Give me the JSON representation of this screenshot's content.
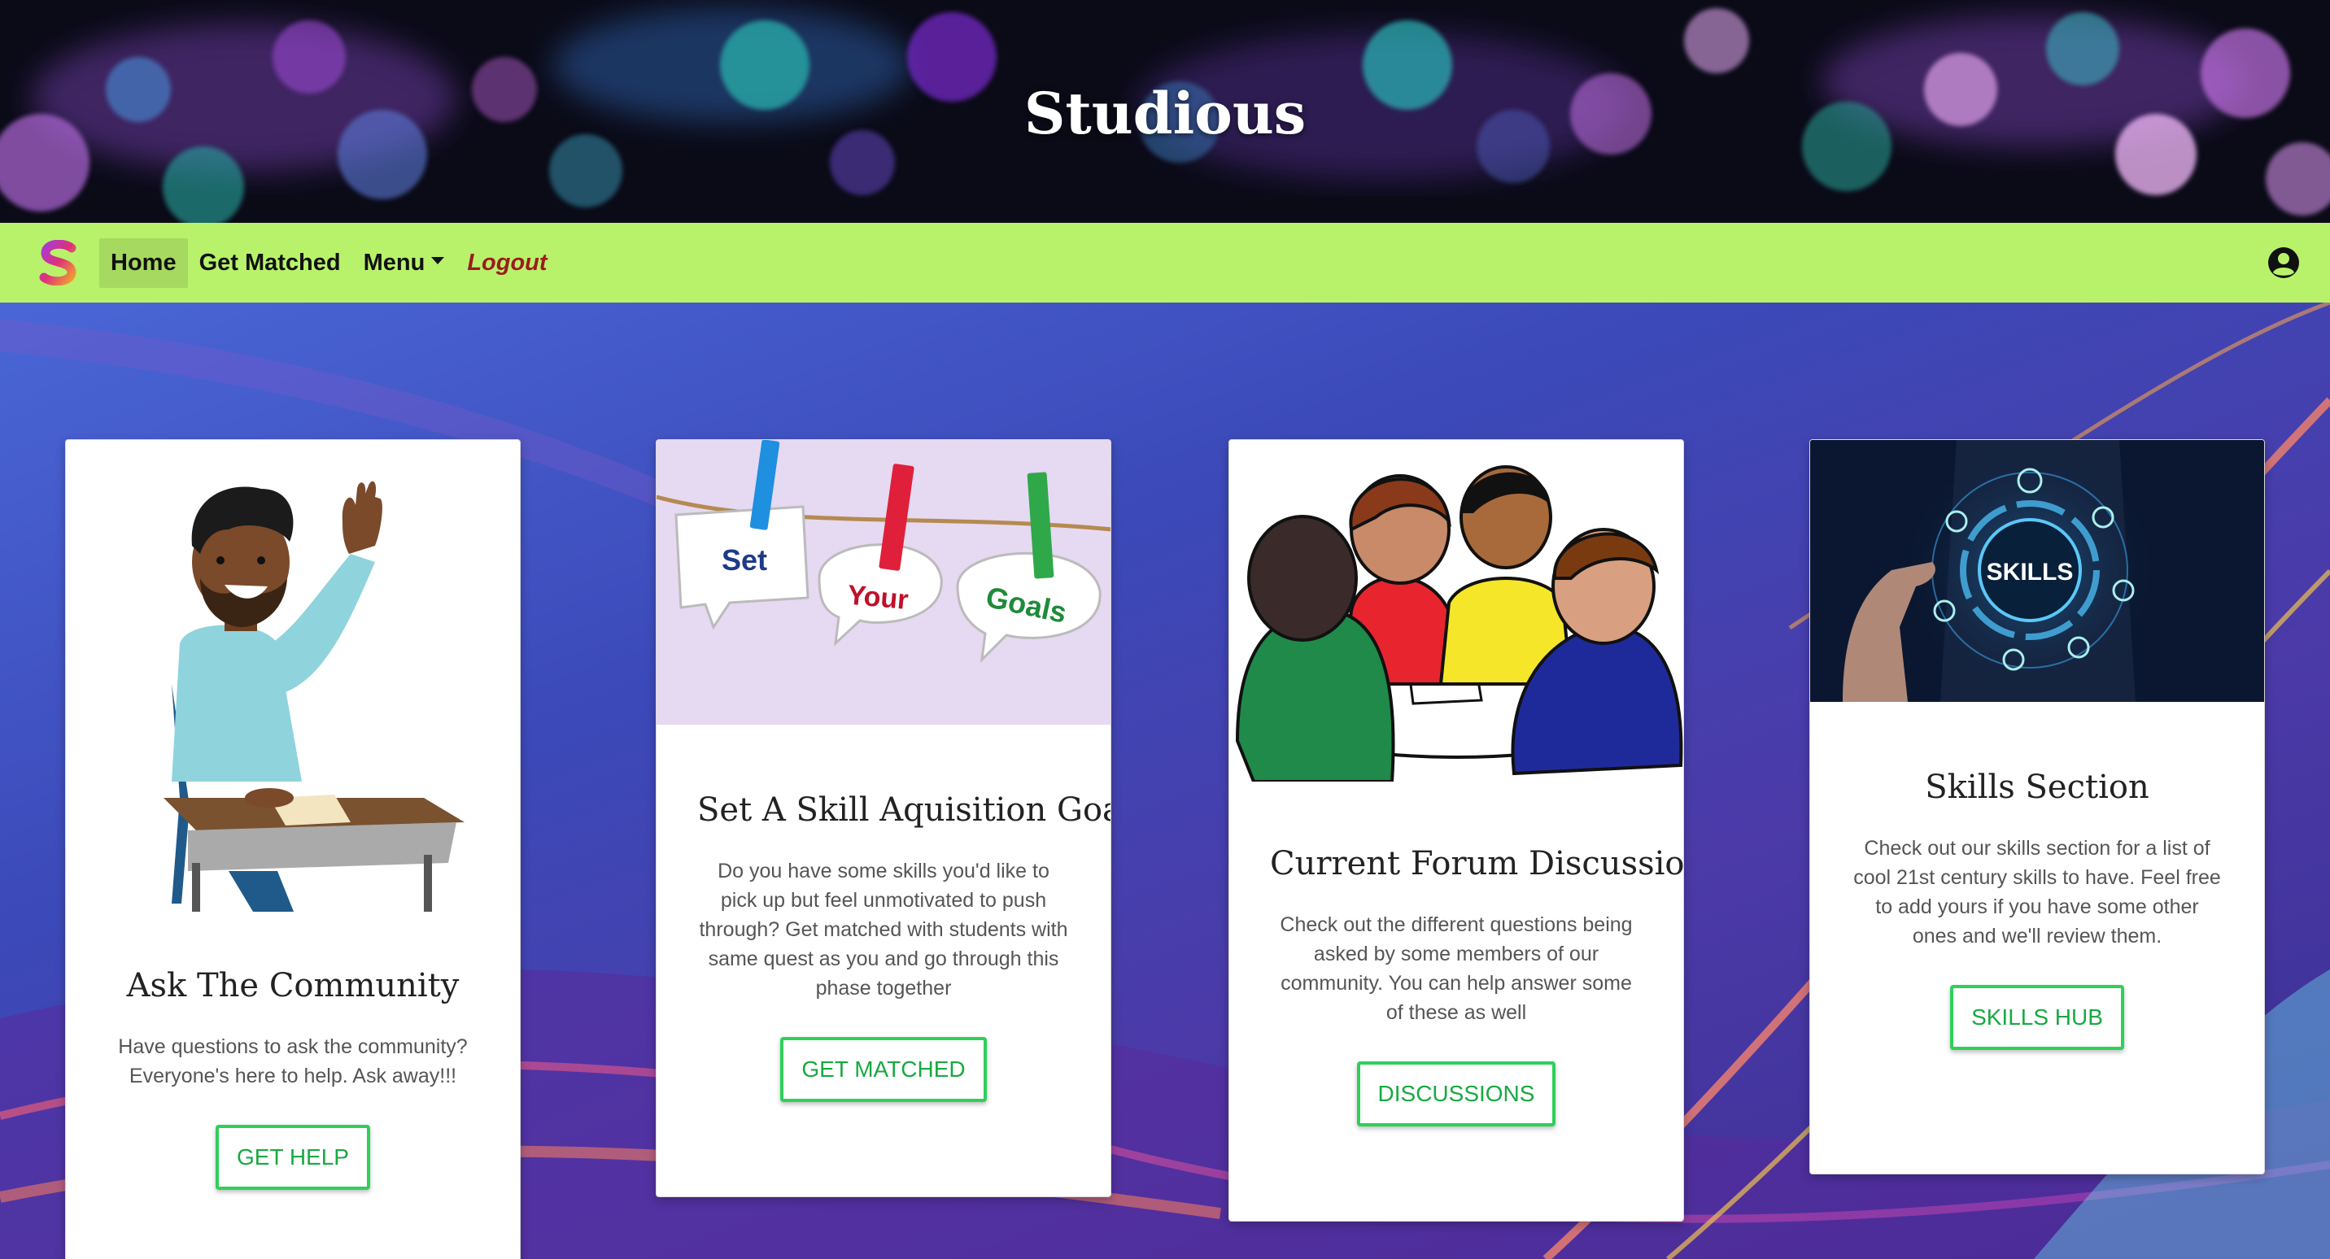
{
  "app": {
    "title": "Studious"
  },
  "nav": {
    "brand_icon": "s-logo-icon",
    "items": [
      {
        "label": "Home",
        "active": true
      },
      {
        "label": "Get Matched"
      },
      {
        "label": "Menu"
      },
      {
        "label": "Logout"
      }
    ],
    "profile_icon": "user-circle-icon"
  },
  "cards": [
    {
      "title": "Ask The Community",
      "text": "Have questions to ask the community? Everyone's here to help. Ask away!!!",
      "button": "GET HELP"
    },
    {
      "title": "Set A Skill Aquisition Goal",
      "text": "Do you have some skills you'd like to pick up but feel unmotivated to push through? Get matched with students with same quest as you and go through this phase together",
      "button": "GET MATCHED",
      "image_words": [
        "Set",
        "Your",
        "Goals"
      ]
    },
    {
      "title": "Current Forum Discussions",
      "text": "Check out the different questions being asked by some members of our community. You can help answer some of these as well",
      "button": "DISCUSSIONS"
    },
    {
      "title": "Skills Section",
      "text": "Check out our skills section for a list of cool 21st century skills to have. Feel free to add yours if you have some other ones and we'll review them.",
      "button": "SKILLS HUB",
      "image_words": [
        "SKILLS"
      ]
    }
  ],
  "colors": {
    "navbar": "#b8f26b",
    "button_border": "#2fcf5a",
    "logout": "#9b1c1c"
  }
}
